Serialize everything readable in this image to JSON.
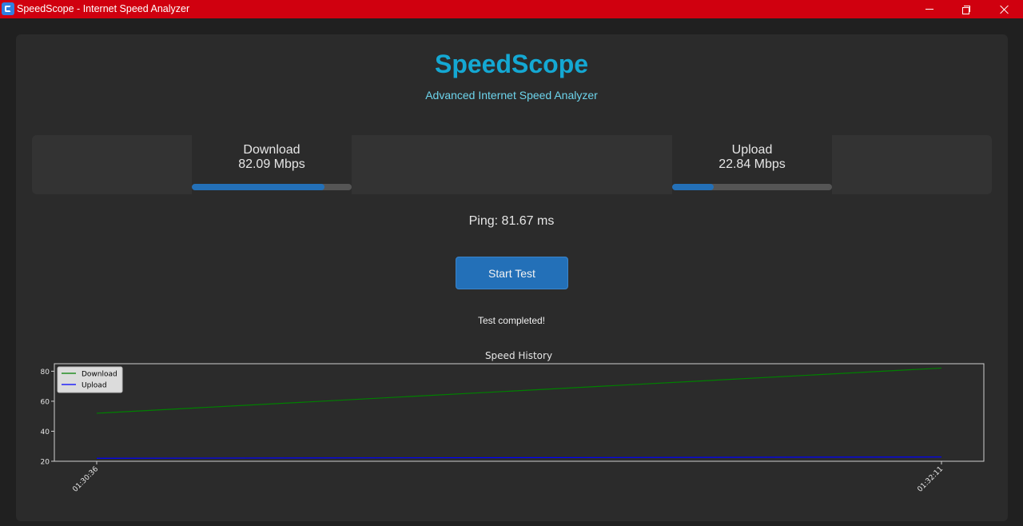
{
  "window": {
    "title": "SpeedScope - Internet Speed Analyzer"
  },
  "header": {
    "title": "SpeedScope",
    "subtitle": "Advanced Internet Speed Analyzer"
  },
  "download": {
    "label": "Download",
    "value_text": "82.09 Mbps",
    "progress_percent": 83
  },
  "upload": {
    "label": "Upload",
    "value_text": "22.84 Mbps",
    "progress_percent": 26
  },
  "ping_text": "Ping: 81.67 ms",
  "start_button_label": "Start Test",
  "status_text": "Test completed!",
  "colors": {
    "title_bar": "#d0000f",
    "accent": "#14a8d3",
    "button": "#2370b8",
    "download_line": "#008000",
    "upload_line": "#0000ff"
  },
  "chart_data": {
    "type": "line",
    "title": "Speed History",
    "x": [
      "01:30:36",
      "01:32:11"
    ],
    "series": [
      {
        "name": "Download",
        "values": [
          52,
          82.09
        ],
        "color": "#008000"
      },
      {
        "name": "Upload",
        "values": [
          22,
          22.84
        ],
        "color": "#0000ff"
      }
    ],
    "yticks": [
      20,
      40,
      60,
      80
    ],
    "ylim": [
      20,
      85
    ],
    "legend": "top-left",
    "grid": false
  }
}
